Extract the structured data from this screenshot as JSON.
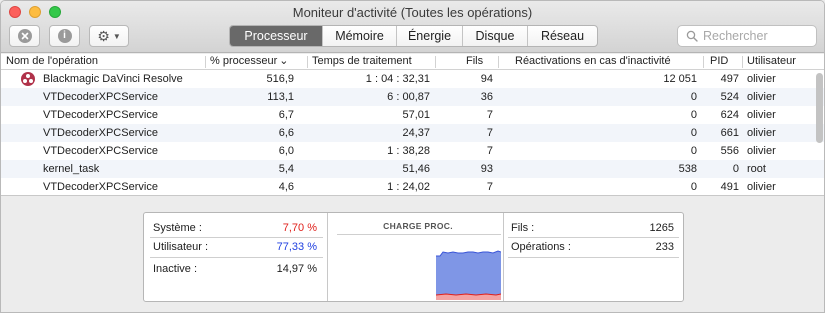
{
  "window": {
    "title": "Moniteur d'activité (Toutes les opérations)"
  },
  "toolbar": {
    "stop_icon": "x-circle-icon",
    "info_icon": "info-circle-icon",
    "info_glyph": "i",
    "gear_icon": "gear-icon",
    "tabs": [
      {
        "label": "Processeur",
        "active": true
      },
      {
        "label": "Mémoire",
        "active": false
      },
      {
        "label": "Énergie",
        "active": false
      },
      {
        "label": "Disque",
        "active": false
      },
      {
        "label": "Réseau",
        "active": false
      }
    ],
    "search_placeholder": "Rechercher"
  },
  "table": {
    "columns": [
      "Nom de l'opération",
      "% processeur",
      "Temps de traitement",
      "Fils",
      "Réactivations en cas d'inactivité",
      "PID",
      "Utilisateur"
    ],
    "sort_indicator": "⌄",
    "rows": [
      {
        "name": "Blackmagic DaVinci Resolve",
        "cpu": "516,9",
        "time": "1 : 04 : 32,31",
        "threads": "94",
        "wakeups": "12 051",
        "pid": "497",
        "user": "olivier",
        "has_icon": true
      },
      {
        "name": "VTDecoderXPCService",
        "cpu": "113,1",
        "time": "6 : 00,87",
        "threads": "36",
        "wakeups": "0",
        "pid": "524",
        "user": "olivier"
      },
      {
        "name": "VTDecoderXPCService",
        "cpu": "6,7",
        "time": "57,01",
        "threads": "7",
        "wakeups": "0",
        "pid": "624",
        "user": "olivier"
      },
      {
        "name": "VTDecoderXPCService",
        "cpu": "6,6",
        "time": "24,37",
        "threads": "7",
        "wakeups": "0",
        "pid": "661",
        "user": "olivier"
      },
      {
        "name": "VTDecoderXPCService",
        "cpu": "6,0",
        "time": "1 : 38,28",
        "threads": "7",
        "wakeups": "0",
        "pid": "556",
        "user": "olivier"
      },
      {
        "name": "kernel_task",
        "cpu": "5,4",
        "time": "51,46",
        "threads": "93",
        "wakeups": "538",
        "pid": "0",
        "user": "root"
      },
      {
        "name": "VTDecoderXPCService",
        "cpu": "4,6",
        "time": "1 : 24,02",
        "threads": "7",
        "wakeups": "0",
        "pid": "491",
        "user": "olivier"
      }
    ]
  },
  "summary": {
    "system_label": "Système :",
    "system_value": "7,70 %",
    "user_label": "Utilisateur :",
    "user_value": "77,33 %",
    "idle_label": "Inactive :",
    "idle_value": "14,97 %",
    "chart_title": "CHARGE PROC.",
    "threads_label": "Fils :",
    "threads_value": "1265",
    "processes_label": "Opérations :",
    "processes_value": "233"
  },
  "colors": {
    "system": "#e0201b",
    "user": "#1f3fe0",
    "active_tab": "#696969",
    "chart_user_fill": "#7f96e6",
    "chart_system_fill": "#f3a3a3"
  }
}
